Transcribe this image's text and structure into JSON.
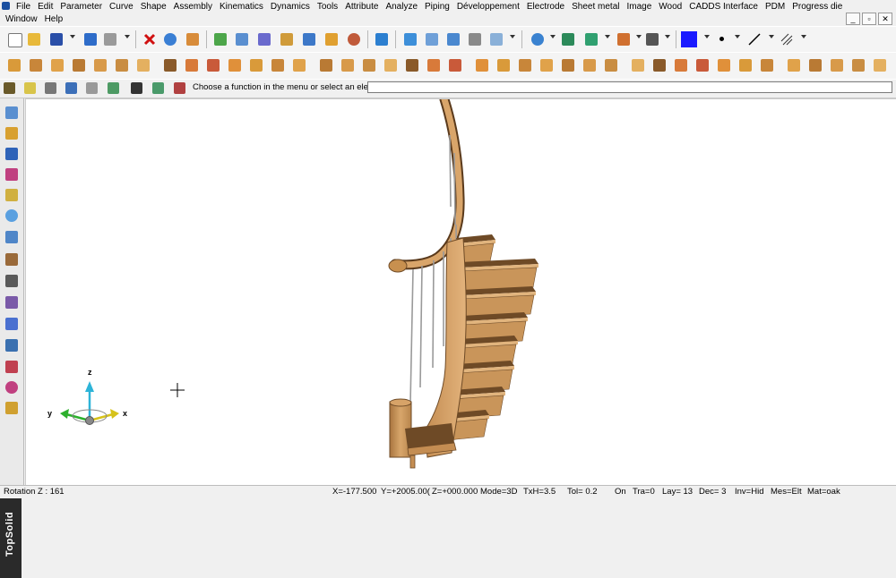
{
  "menubar": {
    "row1": [
      "File",
      "Edit",
      "Parameter",
      "Curve",
      "Shape",
      "Assembly",
      "Kinematics",
      "Dynamics",
      "Tools",
      "Attribute",
      "Analyze",
      "Piping",
      "Développement",
      "Electrode",
      "Sheet metal",
      "Image",
      "Wood",
      "CADDS Interface",
      "PDM",
      "Progress die"
    ],
    "row2": [
      "Window",
      "Help"
    ],
    "window_controls": [
      "_",
      "▫",
      "✕"
    ]
  },
  "toolbar3": {
    "prompt": "Choose a function in the menu or select an element:",
    "input_value": ""
  },
  "left_palette": {
    "brand": "TopSolid"
  },
  "viewport": {
    "triad": {
      "x": "x",
      "y": "y",
      "z": "z"
    }
  },
  "statusbar": {
    "rotation": "Rotation Z : 161",
    "x": "X=-177.500",
    "y": "Y=+2005.00(",
    "z": "Z=+000.000",
    "mode": "Mode=3D",
    "txh": "TxH=3.5",
    "tol": "Tol=  0.2",
    "on": "On",
    "tra": "Tra=0",
    "lay": "Lay= 13",
    "dec": "Dec= 3",
    "inv": "Inv=Hid",
    "mes": "Mes=Elt",
    "mat": "Mat=oak"
  },
  "colors": {
    "wood": "#c9955a",
    "wood_dark": "#6e4a26",
    "wood_light": "#e1b47d",
    "color_swatch": "#1a1aff"
  }
}
